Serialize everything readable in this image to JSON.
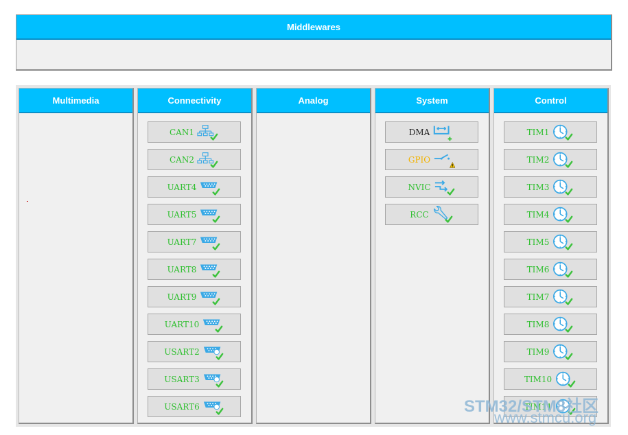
{
  "middlewares": {
    "title": "Middlewares"
  },
  "columns": {
    "multimedia": {
      "title": "Multimedia",
      "items": []
    },
    "connectivity": {
      "title": "Connectivity",
      "items": [
        {
          "label": "CAN1",
          "icon": "network-icon",
          "status": "ok"
        },
        {
          "label": "CAN2",
          "icon": "network-icon",
          "status": "ok"
        },
        {
          "label": "UART4",
          "icon": "serial-port-icon",
          "status": "ok"
        },
        {
          "label": "UART5",
          "icon": "serial-port-icon",
          "status": "ok"
        },
        {
          "label": "UART7",
          "icon": "serial-port-icon",
          "status": "ok"
        },
        {
          "label": "UART8",
          "icon": "serial-port-icon",
          "status": "ok"
        },
        {
          "label": "UART9",
          "icon": "serial-port-icon",
          "status": "ok"
        },
        {
          "label": "UART10",
          "icon": "serial-port-icon",
          "status": "ok"
        },
        {
          "label": "USART2",
          "icon": "serial-port-clock-icon",
          "status": "ok"
        },
        {
          "label": "USART3",
          "icon": "serial-port-clock-icon",
          "status": "ok"
        },
        {
          "label": "USART6",
          "icon": "serial-port-clock-icon",
          "status": "ok"
        }
      ]
    },
    "analog": {
      "title": "Analog",
      "items": []
    },
    "system": {
      "title": "System",
      "items": [
        {
          "label": "DMA",
          "icon": "dma-icon",
          "status": "neutral"
        },
        {
          "label": "GPIO",
          "icon": "gpio-switch-icon",
          "status": "warn"
        },
        {
          "label": "NVIC",
          "icon": "nvic-arrows-icon",
          "status": "ok"
        },
        {
          "label": "RCC",
          "icon": "wrench-icon",
          "status": "ok"
        }
      ]
    },
    "control": {
      "title": "Control",
      "items": [
        {
          "label": "TIM1",
          "icon": "clock-icon",
          "status": "ok"
        },
        {
          "label": "TIM2",
          "icon": "clock-icon",
          "status": "ok"
        },
        {
          "label": "TIM3",
          "icon": "clock-icon",
          "status": "ok"
        },
        {
          "label": "TIM4",
          "icon": "clock-icon",
          "status": "ok"
        },
        {
          "label": "TIM5",
          "icon": "clock-icon",
          "status": "ok"
        },
        {
          "label": "TIM6",
          "icon": "clock-icon",
          "status": "ok"
        },
        {
          "label": "TIM7",
          "icon": "clock-icon",
          "status": "ok"
        },
        {
          "label": "TIM8",
          "icon": "clock-icon",
          "status": "ok"
        },
        {
          "label": "TIM9",
          "icon": "clock-icon",
          "status": "ok"
        },
        {
          "label": "TIM10",
          "icon": "clock-icon",
          "status": "ok"
        },
        {
          "label": "TIM11",
          "icon": "clock-icon",
          "status": "ok"
        }
      ]
    }
  },
  "watermark": {
    "line1": "STM32/STM8社区",
    "line2": "www.stmcu.org"
  },
  "colors": {
    "header": "#00bfff",
    "ok_text": "#2fbf2f",
    "warn_text": "#f2b300",
    "icon_blue": "#3aa9e6",
    "check_green": "#3cc23c"
  }
}
